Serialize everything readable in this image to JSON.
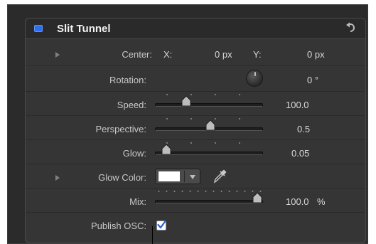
{
  "header": {
    "title": "Slit Tunnel"
  },
  "rows": {
    "center": {
      "label": "Center:",
      "x_label": "X:",
      "x_value": "0 px",
      "y_label": "Y:",
      "y_value": "0 px"
    },
    "rotation": {
      "label": "Rotation:",
      "value": "0 °"
    },
    "speed": {
      "label": "Speed:",
      "value": "100.0"
    },
    "perspective": {
      "label": "Perspective:",
      "value": "0.5"
    },
    "glow": {
      "label": "Glow:",
      "value": "0.05"
    },
    "glow_color": {
      "label": "Glow Color:",
      "swatch_color": "#ffffff"
    },
    "mix": {
      "label": "Mix:",
      "value": "100.0",
      "unit": "%"
    },
    "publish_osc": {
      "label": "Publish OSC:",
      "checked": true
    }
  },
  "colors": {
    "accent": "#2c6ff0",
    "panel": "#353535",
    "header": "#2a2a2a"
  },
  "icons": {
    "reset": "reset-arrow-icon",
    "eyedropper": "eyedropper-icon",
    "checkmark": "checkmark-icon"
  }
}
